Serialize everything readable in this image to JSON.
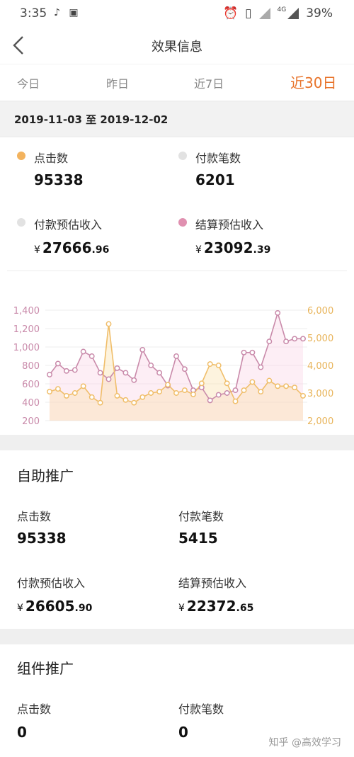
{
  "status": {
    "time": "3:35",
    "battery": "39%",
    "network": "4G"
  },
  "nav": {
    "title": "效果信息"
  },
  "tabs": [
    {
      "label": "今日",
      "active": false
    },
    {
      "label": "昨日",
      "active": false
    },
    {
      "label": "近7日",
      "active": false
    },
    {
      "label": "近30日",
      "active": true
    }
  ],
  "date_range": "2019-11-03 至 2019-12-02",
  "summary": {
    "clicks": {
      "label": "点击数",
      "value": "95338",
      "color": "#f3b35e"
    },
    "orders": {
      "label": "付款笔数",
      "value": "6201",
      "color": "#e2e2e2"
    },
    "pay_income": {
      "label": "付款预估收入",
      "yen": "¥",
      "int": "27666",
      "dec": ".96",
      "color": "#e2e2e2"
    },
    "settle_income": {
      "label": "结算预估收入",
      "yen": "¥",
      "int": "23092",
      "dec": ".39",
      "color": "#e090b0"
    }
  },
  "chart_data": {
    "type": "line",
    "x": [
      1,
      2,
      3,
      4,
      5,
      6,
      7,
      8,
      9,
      10,
      11,
      12,
      13,
      14,
      15,
      16,
      17,
      18,
      19,
      20,
      21,
      22,
      23,
      24,
      25,
      26,
      27,
      28,
      29,
      30,
      31
    ],
    "series": [
      {
        "axis": "left",
        "color": "#c98aaa",
        "values": [
          700,
          820,
          740,
          750,
          950,
          900,
          720,
          650,
          770,
          720,
          640,
          970,
          800,
          720,
          580,
          900,
          760,
          530,
          560,
          420,
          480,
          500,
          530,
          940,
          940,
          780,
          1060,
          1370,
          1060,
          1090,
          1090
        ]
      },
      {
        "axis": "right",
        "color": "#f0be6a",
        "values": [
          3050,
          3150,
          2900,
          3000,
          3250,
          2850,
          2650,
          5500,
          2900,
          2750,
          2650,
          2850,
          3000,
          3050,
          3300,
          3000,
          3100,
          2950,
          3350,
          4050,
          4000,
          3350,
          2700,
          3100,
          3400,
          3050,
          3450,
          3250,
          3250,
          3200,
          2900
        ]
      }
    ],
    "y_left": {
      "ticks": [
        "200",
        "400",
        "600",
        "800",
        "1,000",
        "1,200",
        "1,400"
      ],
      "range": [
        200,
        1400
      ]
    },
    "y_right": {
      "ticks": [
        "2,000",
        "3,000",
        "4,000",
        "5,000",
        "6,000"
      ],
      "range": [
        2000,
        6000
      ]
    },
    "grid": true
  },
  "self_promo": {
    "title": "自助推广",
    "clicks": {
      "label": "点击数",
      "value": "95338"
    },
    "orders": {
      "label": "付款笔数",
      "value": "5415"
    },
    "pay_income": {
      "label": "付款预估收入",
      "yen": "¥",
      "int": "26605",
      "dec": ".90"
    },
    "settle_income": {
      "label": "结算预估收入",
      "yen": "¥",
      "int": "22372",
      "dec": ".65"
    }
  },
  "widget_promo": {
    "title": "组件推广",
    "clicks": {
      "label": "点击数",
      "value": "0"
    },
    "orders": {
      "label": "付款笔数",
      "value": "0"
    }
  },
  "watermark": "知乎 @高效学习"
}
